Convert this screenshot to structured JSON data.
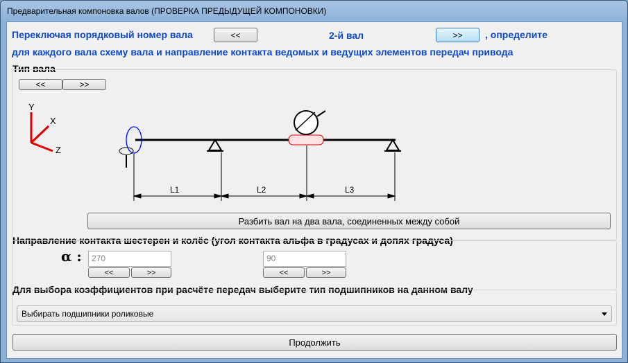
{
  "window": {
    "title": "Предварительная компоновка валов (ПРОВЕРКА ПРЕДЫДУЩЕЙ КОМПОНОВКИ)"
  },
  "shaft_nav": {
    "prefix": "Переключая порядковый номер вала",
    "prev_label": "<<",
    "current_shaft": "2-й вал",
    "next_label": ">>",
    "suffix": ", определите",
    "line2": "для каждого вала схему вала и направление контакта ведомых и ведущих элементов передач привода"
  },
  "shaft_type": {
    "title": "Тип вала",
    "prev_label": "<<",
    "next_label": ">>",
    "axis_y": "Y",
    "axis_x": "X",
    "axis_z": "Z",
    "dim_l1": "L1",
    "dim_l2": "L2",
    "dim_l3": "L3",
    "split_button": "Разбить вал на два вала, соединенных между собой"
  },
  "contact": {
    "title": "Направление контакта шестерен и колёс (угол контакта альфа в градусах и допях градуса)",
    "alpha_symbol": "α :",
    "angle1": {
      "placeholder": "270",
      "prev_label": "<<",
      "next_label": ">>"
    },
    "angle2": {
      "placeholder": "90",
      "prev_label": "<<",
      "next_label": ">>"
    }
  },
  "bearings": {
    "title": "Для выбора коэффициентов при расчёте передач выберите тип подшипников на данном валу",
    "selected": "Выбирать подшипники роликовые"
  },
  "continue_label": "Продолжить",
  "colors": {
    "accent": "#1049c4",
    "axis": "#e00000",
    "diagram": "#000000"
  }
}
